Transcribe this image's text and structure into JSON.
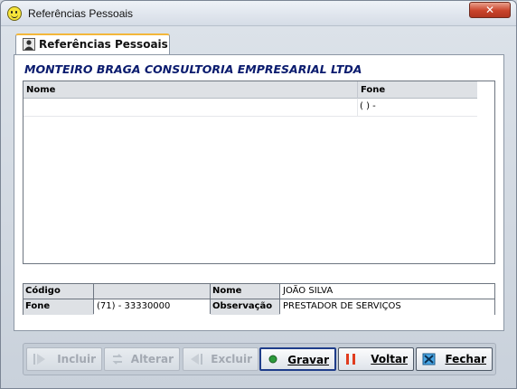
{
  "window": {
    "title": "Referências Pessoais",
    "close_symbol": "✕"
  },
  "tab": {
    "label": "Referências Pessoais",
    "icon": "person-icon"
  },
  "company_name": "MONTEIRO BRAGA CONSULTORIA EMPRESARIAL LTDA",
  "grid": {
    "columns": [
      "Nome",
      "Fone"
    ],
    "rows": [
      {
        "nome": "",
        "fone": "(  ) -"
      }
    ]
  },
  "detail": {
    "codigo_label": "Código",
    "codigo_value": "",
    "nome_label": "Nome",
    "nome_value": "JOÃO SILVA",
    "fone_label": "Fone",
    "fone_value": "(71) - 33330000",
    "observacao_label": "Observação",
    "observacao_value": "PRESTADOR DE SERVIÇOS"
  },
  "buttons": {
    "incluir": "Incluir",
    "alterar": "Alterar",
    "excluir": "Excluir",
    "gravar": "Gravar",
    "voltar": "Voltar",
    "fechar": "Fechar"
  },
  "colors": {
    "company_text": "#0a1b6e",
    "tab_accent": "#f3b73a",
    "close_button": "#c9432b"
  }
}
